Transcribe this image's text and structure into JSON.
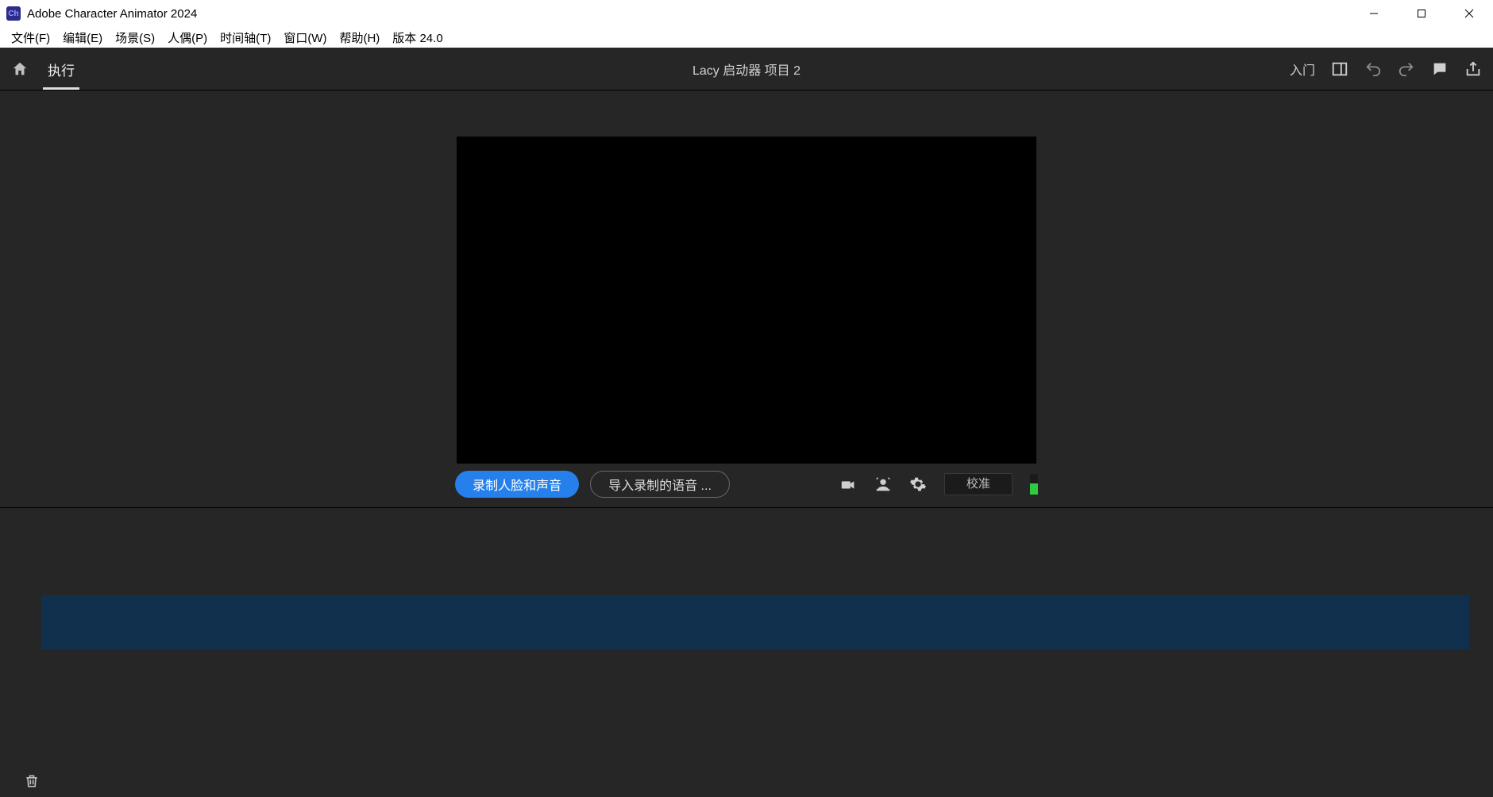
{
  "titlebar": {
    "app_icon_text": "Ch",
    "title": "Adobe Character Animator 2024"
  },
  "menubar": {
    "items": [
      "文件(F)",
      "编辑(E)",
      "场景(S)",
      "人偶(P)",
      "时间轴(T)",
      "窗口(W)",
      "帮助(H)",
      "版本 24.0"
    ]
  },
  "toolbar": {
    "tab_label": "执行",
    "project_title": "Lacy 启动器 项目 2",
    "getting_started_label": "入门"
  },
  "controls": {
    "record_face_voice": "录制人脸和声音",
    "import_recorded_audio": "导入录制的语音 ...",
    "calibrate": "校准"
  }
}
